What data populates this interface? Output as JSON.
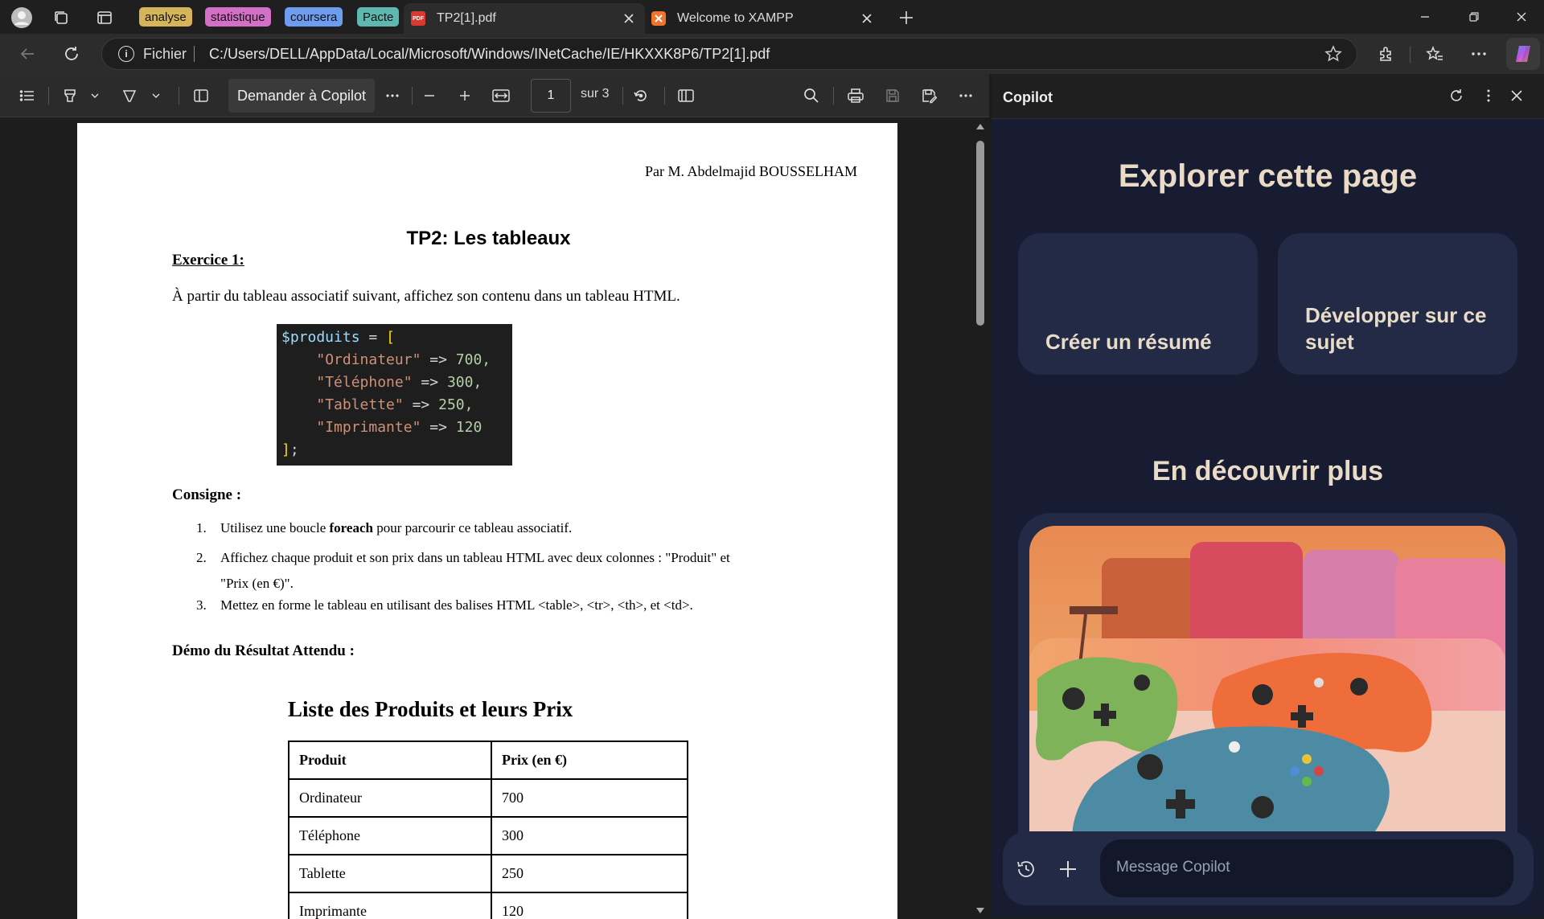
{
  "titlebar": {
    "groups": [
      {
        "label": "analyse",
        "color": "#d6b45a"
      },
      {
        "label": "statistique",
        "color": "#d36fc6"
      },
      {
        "label": "coursera",
        "color": "#6e9df0"
      },
      {
        "label": "Pacte",
        "color": "#5fb8b0"
      }
    ],
    "tabs": [
      {
        "label": "TP2[1].pdf",
        "icon": "pdf-icon",
        "active": true
      },
      {
        "label": "Welcome to XAMPP",
        "icon": "xampp-icon",
        "active": false
      }
    ]
  },
  "addressbar": {
    "scheme_label": "Fichier",
    "url": "C:/Users/DELL/AppData/Local/Microsoft/Windows/INetCache/IE/HKXXK8P6/TP2[1].pdf"
  },
  "pdftoolbar": {
    "ask_copilot": "Demander à Copilot",
    "page_current": "1",
    "page_total": "sur 3"
  },
  "document": {
    "author": "Par M. Abdelmajid BOUSSELHAM",
    "title": "TP2: Les tableaux",
    "exercise": "Exercice 1:",
    "intro": "À partir du tableau associatif suivant, affichez son contenu dans un tableau HTML.",
    "code": {
      "var": "$produits",
      "items": [
        {
          "key": "\"Ordinateur\"",
          "value": "700,"
        },
        {
          "key": "\"Téléphone\"",
          "value": "300,"
        },
        {
          "key": "\"Tablette\"",
          "value": "250,"
        },
        {
          "key": "\"Imprimante\"",
          "value": "120"
        }
      ]
    },
    "consigne_title": "Consigne :",
    "consignes": [
      {
        "num": "1.",
        "pre": "Utilisez une boucle ",
        "bold": "foreach",
        "post": " pour parcourir ce tableau associatif."
      },
      {
        "num": "2.",
        "line1": "Affichez chaque produit et son prix dans un tableau HTML avec deux colonnes : \"Produit\" et",
        "line2": "\"Prix (en €)\"."
      },
      {
        "num": "3.",
        "text": "Mettez en forme le tableau en utilisant des balises HTML <table>, <tr>, <th>, et <td>."
      }
    ],
    "demo_title": "Démo du Résultat Attendu :",
    "result_title": "Liste des Produits et leurs Prix",
    "table_headers": [
      "Produit",
      "Prix (en €)"
    ],
    "table_rows": [
      [
        "Ordinateur",
        "700"
      ],
      [
        "Téléphone",
        "300"
      ],
      [
        "Tablette",
        "250"
      ],
      [
        "Imprimante",
        "120"
      ]
    ]
  },
  "copilot": {
    "title": "Copilot",
    "explore_heading": "Explorer cette page",
    "cards": [
      "Créer un résumé",
      "Développer sur ce sujet"
    ],
    "discover_heading": "En découvrir plus",
    "message_placeholder": "Message Copilot"
  }
}
